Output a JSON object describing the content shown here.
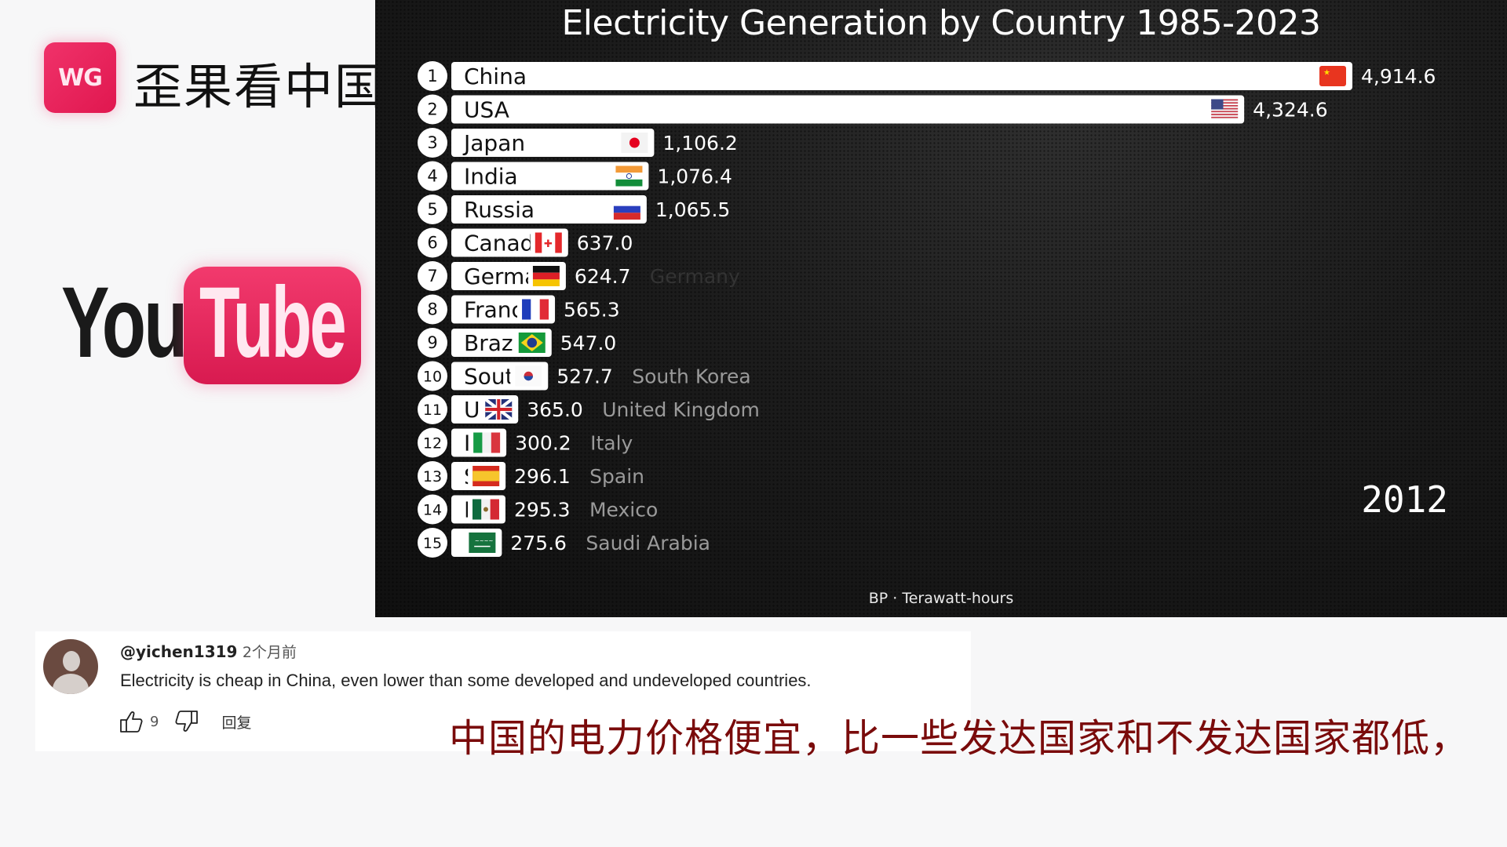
{
  "branding": {
    "channel_logo_text": "WG",
    "channel_name": "歪果看中国",
    "platform_logo_left": "You",
    "platform_logo_right": "Tube"
  },
  "chart_data": {
    "type": "bar",
    "orientation": "horizontal",
    "title": "Electricity Generation by Country 1985-2023",
    "source_label": "BP · Terawatt-hours",
    "unit": "TWh",
    "year": "2012",
    "xlim": [
      0,
      4914.6
    ],
    "categories": [
      "China",
      "USA",
      "Japan",
      "India",
      "Russia",
      "Canada",
      "Germany",
      "France",
      "Brazil",
      "South Korea",
      "United Kingdom",
      "Italy",
      "Spain",
      "Mexico",
      "Saudi Arabia"
    ],
    "bars": [
      {
        "rank": "1",
        "name": "China",
        "value": 4914.6,
        "label": "4,914.6",
        "flag": "cn",
        "outside_name": ""
      },
      {
        "rank": "2",
        "name": "USA",
        "value": 4324.6,
        "label": "4,324.6",
        "flag": "us",
        "outside_name": ""
      },
      {
        "rank": "3",
        "name": "Japan",
        "value": 1106.2,
        "label": "1,106.2",
        "flag": "jp",
        "outside_name": ""
      },
      {
        "rank": "4",
        "name": "India",
        "value": 1076.4,
        "label": "1,076.4",
        "flag": "in",
        "outside_name": ""
      },
      {
        "rank": "5",
        "name": "Russia",
        "value": 1065.5,
        "label": "1,065.5",
        "flag": "ru",
        "outside_name": ""
      },
      {
        "rank": "6",
        "name": "Canada",
        "value": 637.0,
        "label": "637.0",
        "flag": "ca",
        "outside_name": ""
      },
      {
        "rank": "7",
        "name": "Germany",
        "value": 624.7,
        "label": "624.7",
        "flag": "de",
        "outside_name": "Germany",
        "outside_faint": true
      },
      {
        "rank": "8",
        "name": "France",
        "value": 565.3,
        "label": "565.3",
        "flag": "fr",
        "outside_name": ""
      },
      {
        "rank": "9",
        "name": "Brazil",
        "value": 547.0,
        "label": "547.0",
        "flag": "br",
        "outside_name": ""
      },
      {
        "rank": "10",
        "name": "South Korea",
        "value": 527.7,
        "label": "527.7",
        "flag": "kr",
        "outside_name": "South Korea"
      },
      {
        "rank": "11",
        "name": "United Kingdom",
        "value": 365.0,
        "label": "365.0",
        "flag": "gb",
        "outside_name": "United Kingdom"
      },
      {
        "rank": "12",
        "name": "Italy",
        "value": 300.2,
        "label": "300.2",
        "flag": "it",
        "outside_name": "Italy"
      },
      {
        "rank": "13",
        "name": "Spain",
        "value": 296.1,
        "label": "296.1",
        "flag": "es",
        "outside_name": "Spain"
      },
      {
        "rank": "14",
        "name": "Mexico",
        "value": 295.3,
        "label": "295.3",
        "flag": "mx",
        "outside_name": "Mexico"
      },
      {
        "rank": "15",
        "name": "Saudi Arabia",
        "value": 275.6,
        "label": "275.6",
        "flag": "sa",
        "outside_name": "Saudi Arabia"
      }
    ]
  },
  "comment": {
    "handle": "@yichen1319",
    "time": "2个月前",
    "text": "Electricity is cheap in China, even lower than some developed and undeveloped countries.",
    "like_count": "9",
    "reply_label": "回复",
    "icons": [
      "avatar-placeholder",
      "thumbs-up-icon",
      "thumbs-down-icon"
    ]
  },
  "subtitle": {
    "text": "中国的电力价格便宜，比一些发达国家和不发达国家都低，",
    "color": "#7a0b0b"
  }
}
